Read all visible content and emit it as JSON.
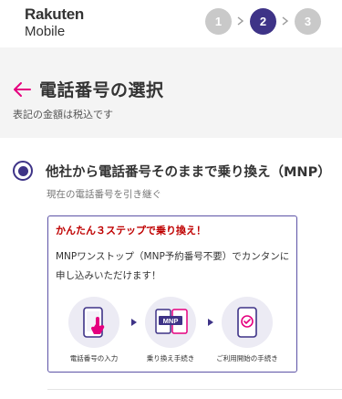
{
  "header": {
    "logo_top": "Rakuten",
    "logo_bottom": "Mobile",
    "steps": [
      "1",
      "2",
      "3"
    ],
    "active_step": "2"
  },
  "page": {
    "title": "電話番号の選択",
    "tax_note": "表記の金額は税込です"
  },
  "option": {
    "label": "他社から電話番号そのままで乗り換え（MNP）",
    "sub": "現在の電話番号を引き継ぐ"
  },
  "info": {
    "heading": "かんたん３ステップで乗り換え！",
    "body": "MNPワンストップ（MNP予約番号不要）でカンタンに申し込みいただけます！",
    "flow": [
      {
        "label": "電話番号の入力",
        "icon": "phone-tap-icon"
      },
      {
        "label": "乗り換え手続き",
        "icon": "mnp-transfer-icon"
      },
      {
        "label": "ご利用開始の手続き",
        "icon": "phone-check-icon"
      }
    ],
    "mnp_badge": "MNP"
  },
  "colors": {
    "brand_purple": "#3e3387",
    "accent_red": "#bf0000",
    "magenta": "#e5007f",
    "step_inactive": "#c9c9c9"
  }
}
